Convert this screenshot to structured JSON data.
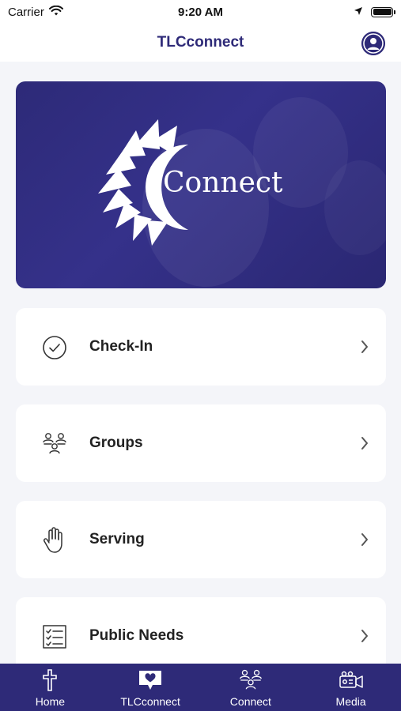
{
  "status_bar": {
    "carrier": "Carrier",
    "time": "9:20 AM"
  },
  "nav": {
    "title": "TLCconnect",
    "profile_icon": "person-circle-icon"
  },
  "hero": {
    "wordmark": "Connect",
    "logo_icon": "sunburst-icon"
  },
  "menu": {
    "items": [
      {
        "label": "Check-In",
        "icon": "check-circle-icon"
      },
      {
        "label": "Groups",
        "icon": "people-group-icon"
      },
      {
        "label": "Serving",
        "icon": "hand-icon"
      },
      {
        "label": "Public Needs",
        "icon": "checklist-icon"
      }
    ]
  },
  "tab_bar": {
    "items": [
      {
        "label": "Home",
        "icon": "cross-icon"
      },
      {
        "label": "TLCconnect",
        "icon": "heart-chat-icon"
      },
      {
        "label": "Connect",
        "icon": "people-group-icon"
      },
      {
        "label": "Media",
        "icon": "video-camera-icon"
      }
    ]
  },
  "colors": {
    "brand": "#2e2a78",
    "background": "#f4f5f9",
    "card": "#ffffff"
  }
}
